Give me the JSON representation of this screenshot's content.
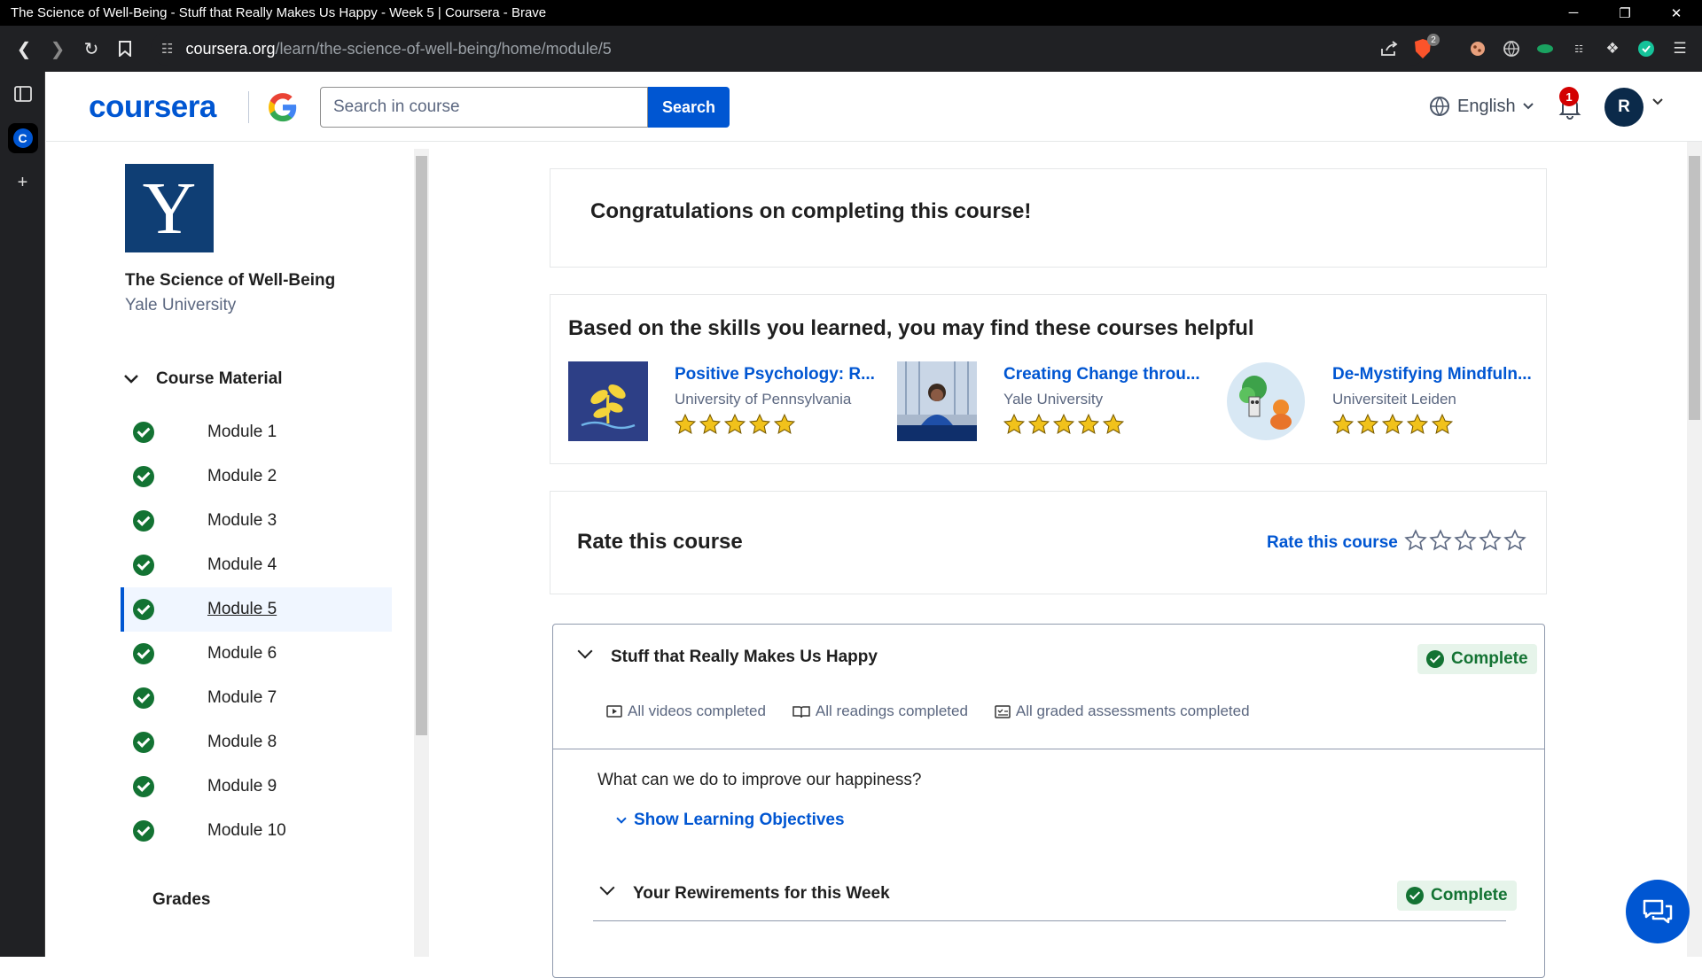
{
  "window": {
    "title": "The Science of Well-Being - Stuff that Really Makes Us Happy - Week 5 | Coursera - Brave",
    "controls": [
      "─",
      "❐",
      "✕"
    ]
  },
  "browser": {
    "url_host": "coursera.org",
    "url_path": "/learn/the-science-of-well-being/home/module/5",
    "shield_count": "2"
  },
  "header": {
    "logo": "coursera",
    "search_placeholder": "Search in course",
    "search_button": "Search",
    "language": "English",
    "notification_count": "1",
    "avatar_initial": "R"
  },
  "sidebar": {
    "logo_letter": "Y",
    "course_title": "The Science of Well-Being",
    "university": "Yale University",
    "section_label": "Course Material",
    "modules": [
      "Module 1",
      "Module 2",
      "Module 3",
      "Module 4",
      "Module 5",
      "Module 6",
      "Module 7",
      "Module 8",
      "Module 9",
      "Module 10"
    ],
    "active_module": "Module 5",
    "grades_label": "Grades"
  },
  "main": {
    "congrats": "Congratulations on completing this course!",
    "recs_title": "Based on the skills you learned, you may find these courses helpful",
    "recommendations": [
      {
        "name": "Positive Psychology: R...",
        "university": "University of Pennsylvania",
        "rating": 5
      },
      {
        "name": "Creating Change throu...",
        "university": "Yale University",
        "rating": 5
      },
      {
        "name": "De-Mystifying Mindfuln...",
        "university": "Universiteit Leiden",
        "rating": 5
      }
    ],
    "rate_title": "Rate this course",
    "rate_link": "Rate this course",
    "rate_value": 0,
    "module_card": {
      "title": "Stuff that Really Makes Us Happy",
      "status": "Complete",
      "stats": [
        "All videos completed",
        "All readings completed",
        "All graded assessments completed"
      ],
      "question": "What can we do to improve our happiness?",
      "objectives_link": "Show Learning Objectives",
      "sub_title": "Your Rewirements for this Week",
      "sub_status": "Complete"
    }
  },
  "colors": {
    "brand": "#0056d2",
    "complete": "#137333",
    "star": "#f1c21b",
    "yale": "#0f3e74"
  }
}
